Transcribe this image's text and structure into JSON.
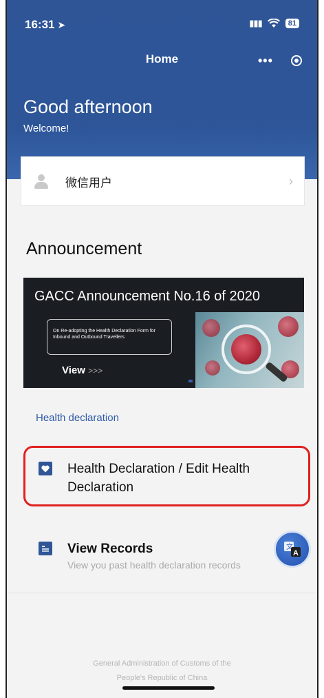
{
  "status_bar": {
    "time": "16:31",
    "location_icon": "location-arrow-icon",
    "signal_icon": "cellular-signal-icon",
    "wifi_icon": "wifi-icon",
    "battery": "81"
  },
  "nav": {
    "title": "Home",
    "more_icon": "more-dots-icon",
    "close_icon": "target-circle-icon"
  },
  "hero": {
    "greeting": "Good afternoon",
    "welcome": "Welcome!"
  },
  "user_card": {
    "avatar_icon": "user-avatar-icon",
    "name": "微信用户",
    "chevron_icon": "chevron-right-icon"
  },
  "announcement": {
    "section_title": "Announcement",
    "banner": {
      "title": "GACC Announcement No.16 of 2020",
      "box_text": "On Re-adopting the Health Declaration Form for Inbound and Outbound Travellers",
      "view_label": "View",
      "view_chevrons": ">>>"
    }
  },
  "health": {
    "section_label": "Health declaration",
    "items": [
      {
        "icon": "heart-icon",
        "label": "Health Declaration / Edit Health Declaration"
      },
      {
        "icon": "records-list-icon",
        "label": "View Records",
        "sub": "View you past health declaration records"
      }
    ]
  },
  "translate_button": {
    "icon": "translate-icon"
  },
  "footer": {
    "line1": "General Administration of Customs of the",
    "line2": "People's Republic of China"
  },
  "colors": {
    "primary": "#2f5597",
    "highlight": "#e02020",
    "section_label": "#2f5aa8"
  }
}
